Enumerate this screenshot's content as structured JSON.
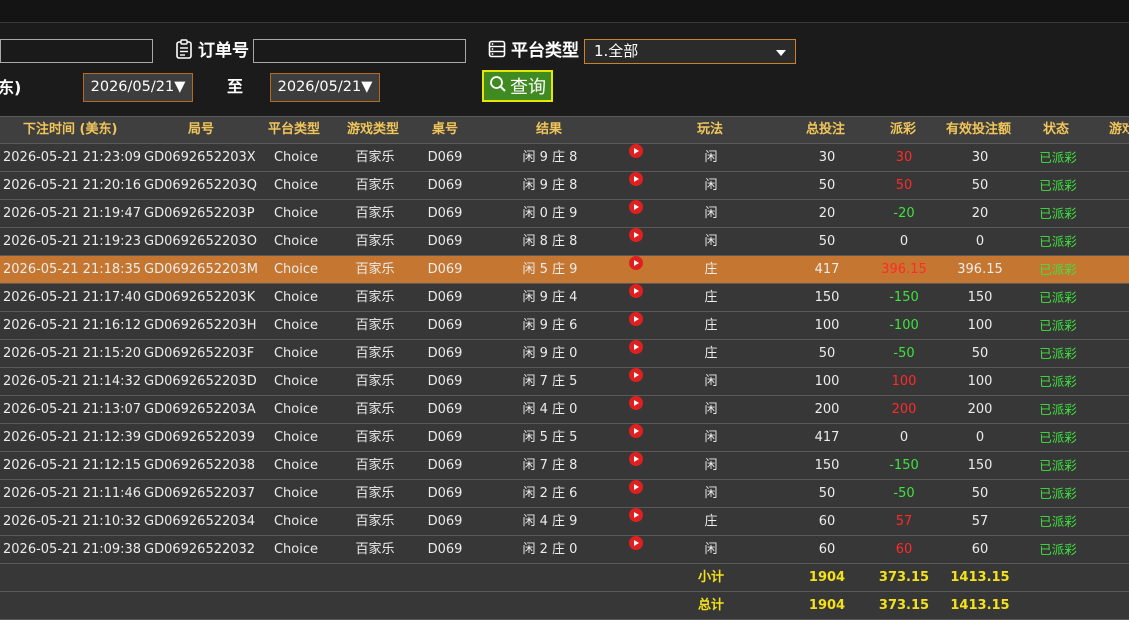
{
  "filters": {
    "order_label": "订单号",
    "order_value": "",
    "platform_label": "平台类型",
    "platform_selected": "1.全部",
    "cut_label": "东)",
    "date_from": "2026/05/21▼",
    "to_label": "至",
    "date_to": "2026/05/21▼",
    "search_label": "查询"
  },
  "table": {
    "headers": [
      "下注时间 (美东)",
      "局号",
      "平台类型",
      "游戏类型",
      "桌号",
      "结果",
      "玩法",
      "总投注",
      "派彩",
      "有效投注额",
      "状态",
      "游戏"
    ],
    "rows": [
      {
        "time": "2026-05-21 21:23:09",
        "id": "GD0692652203X",
        "platform": "Choice",
        "game": "百家乐",
        "table": "D069",
        "result": "闲 9 庄 8",
        "bet": "闲",
        "total": "30",
        "payout": "30",
        "payout_color": "#ff2a2a",
        "valid": "30",
        "status": "已派彩"
      },
      {
        "time": "2026-05-21 21:20:16",
        "id": "GD0692652203Q",
        "platform": "Choice",
        "game": "百家乐",
        "table": "D069",
        "result": "闲 9 庄 8",
        "bet": "闲",
        "total": "50",
        "payout": "50",
        "payout_color": "#ff2a2a",
        "valid": "50",
        "status": "已派彩"
      },
      {
        "time": "2026-05-21 21:19:47",
        "id": "GD0692652203P",
        "platform": "Choice",
        "game": "百家乐",
        "table": "D069",
        "result": "闲 0 庄 9",
        "bet": "闲",
        "total": "20",
        "payout": "-20",
        "payout_color": "#3fe23f",
        "valid": "20",
        "status": "已派彩"
      },
      {
        "time": "2026-05-21 21:19:23",
        "id": "GD0692652203O",
        "platform": "Choice",
        "game": "百家乐",
        "table": "D069",
        "result": "闲 8 庄 8",
        "bet": "闲",
        "total": "50",
        "payout": "0",
        "payout_color": "#ececec",
        "valid": "0",
        "status": "已派彩"
      },
      {
        "time": "2026-05-21 21:18:35",
        "id": "GD0692652203M",
        "platform": "Choice",
        "game": "百家乐",
        "table": "D069",
        "result": "闲 5 庄 9",
        "bet": "庄",
        "total": "417",
        "payout": "396.15",
        "payout_color": "#ff2a2a",
        "valid": "396.15",
        "status": "已派彩",
        "highlight": true
      },
      {
        "time": "2026-05-21 21:17:40",
        "id": "GD0692652203K",
        "platform": "Choice",
        "game": "百家乐",
        "table": "D069",
        "result": "闲 9 庄 4",
        "bet": "庄",
        "total": "150",
        "payout": "-150",
        "payout_color": "#3fe23f",
        "valid": "150",
        "status": "已派彩"
      },
      {
        "time": "2026-05-21 21:16:12",
        "id": "GD0692652203H",
        "platform": "Choice",
        "game": "百家乐",
        "table": "D069",
        "result": "闲 9 庄 6",
        "bet": "庄",
        "total": "100",
        "payout": "-100",
        "payout_color": "#3fe23f",
        "valid": "100",
        "status": "已派彩"
      },
      {
        "time": "2026-05-21 21:15:20",
        "id": "GD0692652203F",
        "platform": "Choice",
        "game": "百家乐",
        "table": "D069",
        "result": "闲 9 庄 0",
        "bet": "庄",
        "total": "50",
        "payout": "-50",
        "payout_color": "#3fe23f",
        "valid": "50",
        "status": "已派彩"
      },
      {
        "time": "2026-05-21 21:14:32",
        "id": "GD0692652203D",
        "platform": "Choice",
        "game": "百家乐",
        "table": "D069",
        "result": "闲 7 庄 5",
        "bet": "闲",
        "total": "100",
        "payout": "100",
        "payout_color": "#ff2a2a",
        "valid": "100",
        "status": "已派彩"
      },
      {
        "time": "2026-05-21 21:13:07",
        "id": "GD0692652203A",
        "platform": "Choice",
        "game": "百家乐",
        "table": "D069",
        "result": "闲 4 庄 0",
        "bet": "闲",
        "total": "200",
        "payout": "200",
        "payout_color": "#ff2a2a",
        "valid": "200",
        "status": "已派彩"
      },
      {
        "time": "2026-05-21 21:12:39",
        "id": "GD06926522039",
        "platform": "Choice",
        "game": "百家乐",
        "table": "D069",
        "result": "闲 5 庄 5",
        "bet": "闲",
        "total": "417",
        "payout": "0",
        "payout_color": "#ececec",
        "valid": "0",
        "status": "已派彩"
      },
      {
        "time": "2026-05-21 21:12:15",
        "id": "GD06926522038",
        "platform": "Choice",
        "game": "百家乐",
        "table": "D069",
        "result": "闲 7 庄 8",
        "bet": "闲",
        "total": "150",
        "payout": "-150",
        "payout_color": "#3fe23f",
        "valid": "150",
        "status": "已派彩"
      },
      {
        "time": "2026-05-21 21:11:46",
        "id": "GD06926522037",
        "platform": "Choice",
        "game": "百家乐",
        "table": "D069",
        "result": "闲 2 庄 6",
        "bet": "闲",
        "total": "50",
        "payout": "-50",
        "payout_color": "#3fe23f",
        "valid": "50",
        "status": "已派彩"
      },
      {
        "time": "2026-05-21 21:10:32",
        "id": "GD06926522034",
        "platform": "Choice",
        "game": "百家乐",
        "table": "D069",
        "result": "闲 4 庄 9",
        "bet": "庄",
        "total": "60",
        "payout": "57",
        "payout_color": "#ff2a2a",
        "valid": "57",
        "status": "已派彩"
      },
      {
        "time": "2026-05-21 21:09:38",
        "id": "GD06926522032",
        "platform": "Choice",
        "game": "百家乐",
        "table": "D069",
        "result": "闲 2 庄 0",
        "bet": "闲",
        "total": "60",
        "payout": "60",
        "payout_color": "#ff2a2a",
        "valid": "60",
        "status": "已派彩"
      }
    ],
    "subtotal": {
      "label": "小计",
      "total": "1904",
      "payout": "373.15",
      "valid": "1413.15"
    },
    "grand_total": {
      "label": "总计",
      "total": "1904",
      "payout": "373.15",
      "valid": "1413.15"
    }
  },
  "colors": {
    "status_green": "#3fe23f",
    "header_gold": "#f0c55a",
    "sum_yellow": "#f3e21a",
    "highlight_row": "#c57731"
  }
}
